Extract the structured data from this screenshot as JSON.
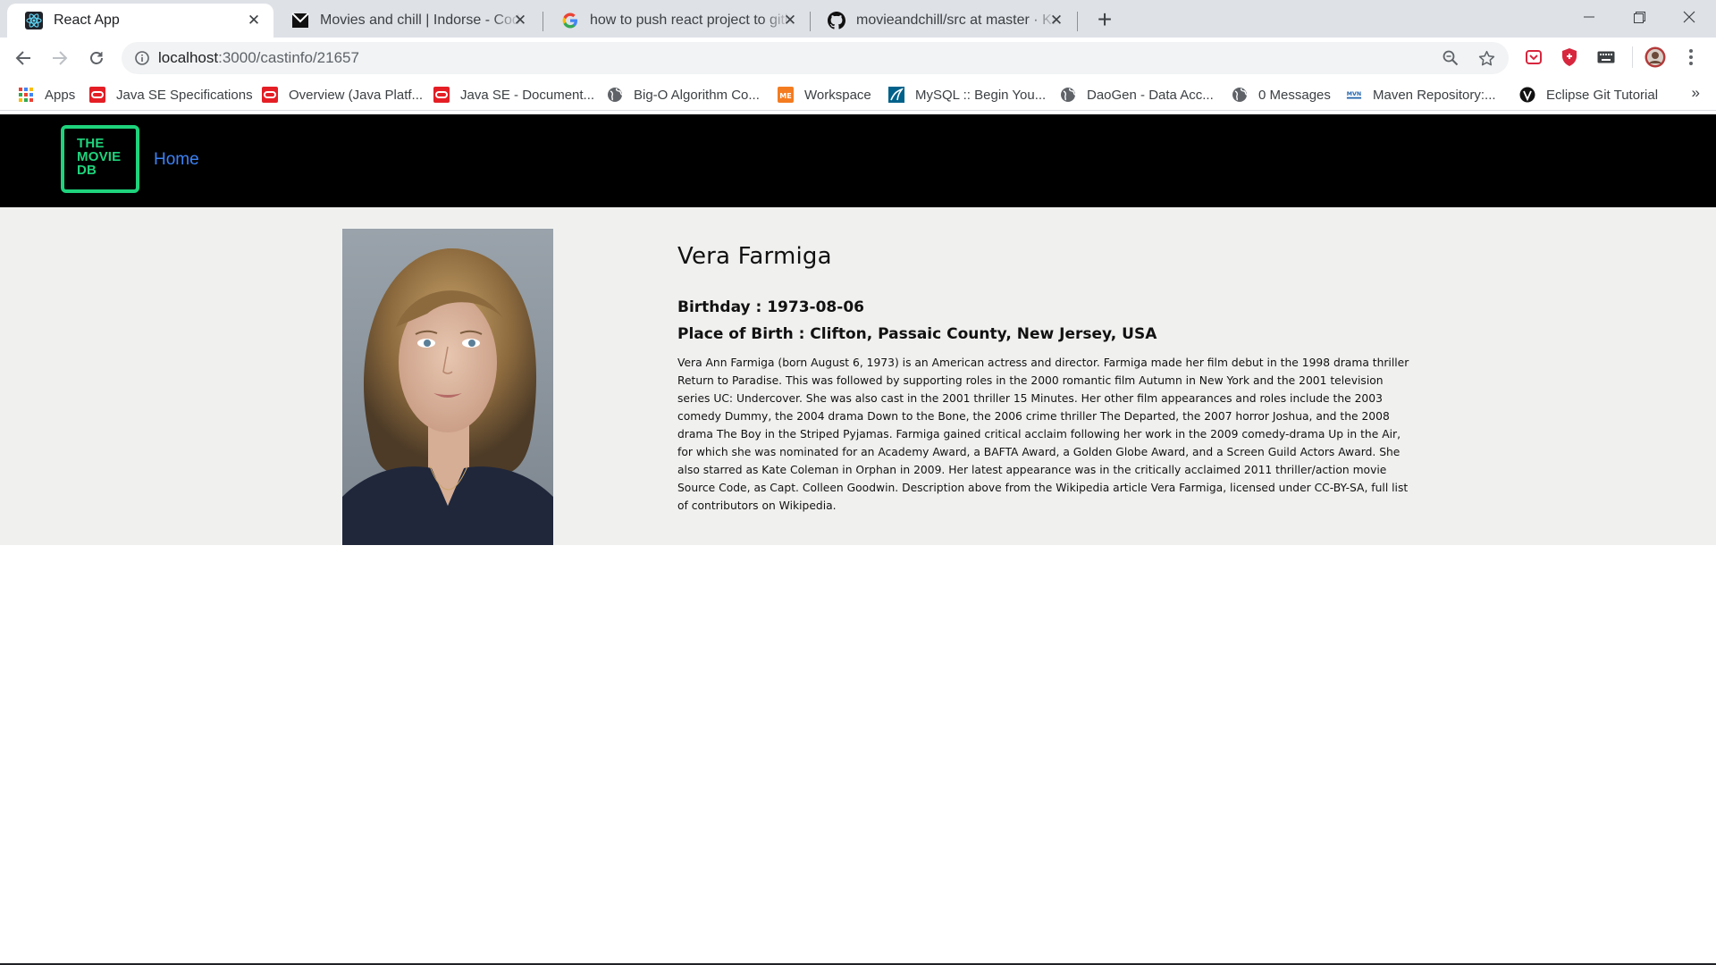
{
  "browser": {
    "tabs": [
      {
        "title": "React App",
        "active": true,
        "icon": "react-icon"
      },
      {
        "title": "Movies and chill | Indorse - Coding",
        "active": false,
        "icon": "indorse-icon"
      },
      {
        "title": "how to push react project to github",
        "active": false,
        "icon": "google-icon"
      },
      {
        "title": "movieandchill/src at master · Kath",
        "active": false,
        "icon": "github-icon"
      }
    ],
    "address": {
      "host": "localhost",
      "path": ":3000/castinfo/21657"
    },
    "bookmarks": [
      {
        "label": "Apps",
        "icon": "apps-grid-icon"
      },
      {
        "label": "Java SE Specifications",
        "icon": "oracle-icon"
      },
      {
        "label": "Overview (Java Platf...",
        "icon": "oracle-icon"
      },
      {
        "label": "Java SE - Document...",
        "icon": "oracle-icon"
      },
      {
        "label": "Big-O Algorithm Co...",
        "icon": "globe-icon"
      },
      {
        "label": "Workspace",
        "icon": "me-icon"
      },
      {
        "label": "MySQL :: Begin You...",
        "icon": "mysql-icon"
      },
      {
        "label": "DaoGen - Data Acc...",
        "icon": "globe-icon"
      },
      {
        "label": "0 Messages",
        "icon": "globe-icon"
      },
      {
        "label": "Maven Repository:...",
        "icon": "maven-icon"
      },
      {
        "label": "Eclipse Git Tutorial",
        "icon": "vogella-icon"
      }
    ],
    "more": "»"
  },
  "site": {
    "logo_lines": [
      "THE",
      "MOVIE",
      "DB"
    ],
    "nav": {
      "home": "Home"
    },
    "accent": "#1ed37c",
    "link_color": "#3b82f6"
  },
  "person": {
    "name": "Vera Farmiga",
    "birthday_label": "Birthday : 1973-08-06",
    "place_of_birth_label": "Place of Birth : Clifton, Passaic County, New Jersey, USA",
    "biography": "Vera Ann Farmiga (born August 6, 1973) is an American actress and director. Farmiga made her film debut in the 1998 drama thriller Return to Paradise. This was followed by supporting roles in the 2000 romantic film Autumn in New York and the 2001 television series UC: Undercover. She was also cast in the 2001 thriller 15 Minutes. Her other film appearances and roles include the 2003 comedy Dummy, the 2004 drama Down to the Bone, the 2006 crime thriller The Departed, the 2007 horror Joshua, and the 2008 drama The Boy in the Striped Pyjamas. Farmiga gained critical acclaim following her work in the 2009 comedy-drama Up in the Air, for which she was nominated for an Academy Award, a BAFTA Award, a Golden Globe Award, and a Screen Guild Actors Award. She also starred as Kate Coleman in Orphan in 2009. Her latest appearance was in the critically acclaimed 2011 thriller/action movie Source Code, as Capt. Colleen Goodwin. Description above from the Wikipedia article Vera Farmiga, licensed under CC-BY-SA, full list of contributors on Wikipedia."
  }
}
